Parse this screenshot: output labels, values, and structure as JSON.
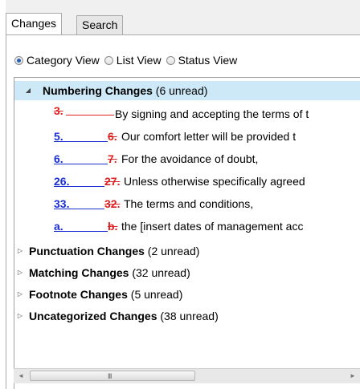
{
  "tabs": [
    {
      "label": "Changes",
      "active": true
    },
    {
      "label": "Search",
      "active": false
    }
  ],
  "view_options": {
    "selected": "Category View",
    "options": [
      "Category View",
      "List View",
      "Status View"
    ]
  },
  "tree": {
    "expanded_category": {
      "name": "Numbering Changes",
      "unread": "(6 unread)",
      "changes": [
        {
          "old": "3.",
          "new": "",
          "text": "By signing and accepting the terms of t"
        },
        {
          "old": "6.",
          "new": "5.",
          "text": "Our comfort letter will be provided t"
        },
        {
          "old": "7.",
          "new": "6.",
          "text": "For the avoidance of doubt,"
        },
        {
          "old": "27.",
          "new": "26.",
          "text": "Unless otherwise specifically agreed"
        },
        {
          "old": "32.",
          "new": "33.",
          "text": "The terms and conditions,"
        },
        {
          "old": "b.",
          "new": "a.",
          "text": "the [insert dates of management acc"
        }
      ]
    },
    "collapsed_categories": [
      {
        "name": "Punctuation Changes",
        "unread": "(2 unread)"
      },
      {
        "name": "Matching Changes",
        "unread": "(32 unread)"
      },
      {
        "name": "Footnote Changes",
        "unread": "(5 unread)"
      },
      {
        "name": "Uncategorized Changes",
        "unread": "(38 unread)"
      }
    ]
  },
  "scrollbar": {
    "grip": "III",
    "left_arrow": "◄",
    "right_arrow": "►"
  },
  "colors": {
    "deleted": "#e02020",
    "inserted": "#1a2fd0",
    "selection": "#cde8f7"
  }
}
